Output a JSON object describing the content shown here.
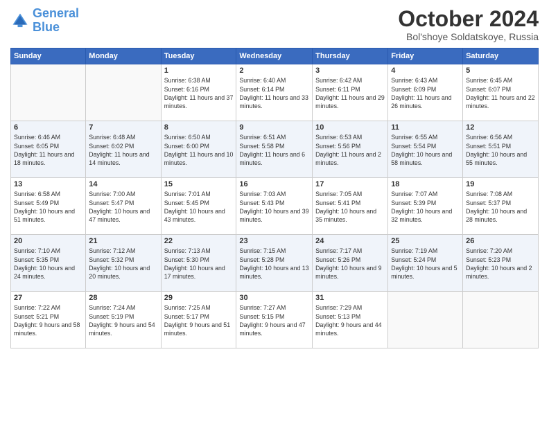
{
  "logo": {
    "line1": "General",
    "line2": "Blue"
  },
  "title": "October 2024",
  "subtitle": "Bol'shoye Soldatskoye, Russia",
  "days_of_week": [
    "Sunday",
    "Monday",
    "Tuesday",
    "Wednesday",
    "Thursday",
    "Friday",
    "Saturday"
  ],
  "weeks": [
    [
      {
        "day": "",
        "sunrise": "",
        "sunset": "",
        "daylight": ""
      },
      {
        "day": "",
        "sunrise": "",
        "sunset": "",
        "daylight": ""
      },
      {
        "day": "1",
        "sunrise": "Sunrise: 6:38 AM",
        "sunset": "Sunset: 6:16 PM",
        "daylight": "Daylight: 11 hours and 37 minutes."
      },
      {
        "day": "2",
        "sunrise": "Sunrise: 6:40 AM",
        "sunset": "Sunset: 6:14 PM",
        "daylight": "Daylight: 11 hours and 33 minutes."
      },
      {
        "day": "3",
        "sunrise": "Sunrise: 6:42 AM",
        "sunset": "Sunset: 6:11 PM",
        "daylight": "Daylight: 11 hours and 29 minutes."
      },
      {
        "day": "4",
        "sunrise": "Sunrise: 6:43 AM",
        "sunset": "Sunset: 6:09 PM",
        "daylight": "Daylight: 11 hours and 26 minutes."
      },
      {
        "day": "5",
        "sunrise": "Sunrise: 6:45 AM",
        "sunset": "Sunset: 6:07 PM",
        "daylight": "Daylight: 11 hours and 22 minutes."
      }
    ],
    [
      {
        "day": "6",
        "sunrise": "Sunrise: 6:46 AM",
        "sunset": "Sunset: 6:05 PM",
        "daylight": "Daylight: 11 hours and 18 minutes."
      },
      {
        "day": "7",
        "sunrise": "Sunrise: 6:48 AM",
        "sunset": "Sunset: 6:02 PM",
        "daylight": "Daylight: 11 hours and 14 minutes."
      },
      {
        "day": "8",
        "sunrise": "Sunrise: 6:50 AM",
        "sunset": "Sunset: 6:00 PM",
        "daylight": "Daylight: 11 hours and 10 minutes."
      },
      {
        "day": "9",
        "sunrise": "Sunrise: 6:51 AM",
        "sunset": "Sunset: 5:58 PM",
        "daylight": "Daylight: 11 hours and 6 minutes."
      },
      {
        "day": "10",
        "sunrise": "Sunrise: 6:53 AM",
        "sunset": "Sunset: 5:56 PM",
        "daylight": "Daylight: 11 hours and 2 minutes."
      },
      {
        "day": "11",
        "sunrise": "Sunrise: 6:55 AM",
        "sunset": "Sunset: 5:54 PM",
        "daylight": "Daylight: 10 hours and 58 minutes."
      },
      {
        "day": "12",
        "sunrise": "Sunrise: 6:56 AM",
        "sunset": "Sunset: 5:51 PM",
        "daylight": "Daylight: 10 hours and 55 minutes."
      }
    ],
    [
      {
        "day": "13",
        "sunrise": "Sunrise: 6:58 AM",
        "sunset": "Sunset: 5:49 PM",
        "daylight": "Daylight: 10 hours and 51 minutes."
      },
      {
        "day": "14",
        "sunrise": "Sunrise: 7:00 AM",
        "sunset": "Sunset: 5:47 PM",
        "daylight": "Daylight: 10 hours and 47 minutes."
      },
      {
        "day": "15",
        "sunrise": "Sunrise: 7:01 AM",
        "sunset": "Sunset: 5:45 PM",
        "daylight": "Daylight: 10 hours and 43 minutes."
      },
      {
        "day": "16",
        "sunrise": "Sunrise: 7:03 AM",
        "sunset": "Sunset: 5:43 PM",
        "daylight": "Daylight: 10 hours and 39 minutes."
      },
      {
        "day": "17",
        "sunrise": "Sunrise: 7:05 AM",
        "sunset": "Sunset: 5:41 PM",
        "daylight": "Daylight: 10 hours and 35 minutes."
      },
      {
        "day": "18",
        "sunrise": "Sunrise: 7:07 AM",
        "sunset": "Sunset: 5:39 PM",
        "daylight": "Daylight: 10 hours and 32 minutes."
      },
      {
        "day": "19",
        "sunrise": "Sunrise: 7:08 AM",
        "sunset": "Sunset: 5:37 PM",
        "daylight": "Daylight: 10 hours and 28 minutes."
      }
    ],
    [
      {
        "day": "20",
        "sunrise": "Sunrise: 7:10 AM",
        "sunset": "Sunset: 5:35 PM",
        "daylight": "Daylight: 10 hours and 24 minutes."
      },
      {
        "day": "21",
        "sunrise": "Sunrise: 7:12 AM",
        "sunset": "Sunset: 5:32 PM",
        "daylight": "Daylight: 10 hours and 20 minutes."
      },
      {
        "day": "22",
        "sunrise": "Sunrise: 7:13 AM",
        "sunset": "Sunset: 5:30 PM",
        "daylight": "Daylight: 10 hours and 17 minutes."
      },
      {
        "day": "23",
        "sunrise": "Sunrise: 7:15 AM",
        "sunset": "Sunset: 5:28 PM",
        "daylight": "Daylight: 10 hours and 13 minutes."
      },
      {
        "day": "24",
        "sunrise": "Sunrise: 7:17 AM",
        "sunset": "Sunset: 5:26 PM",
        "daylight": "Daylight: 10 hours and 9 minutes."
      },
      {
        "day": "25",
        "sunrise": "Sunrise: 7:19 AM",
        "sunset": "Sunset: 5:24 PM",
        "daylight": "Daylight: 10 hours and 5 minutes."
      },
      {
        "day": "26",
        "sunrise": "Sunrise: 7:20 AM",
        "sunset": "Sunset: 5:23 PM",
        "daylight": "Daylight: 10 hours and 2 minutes."
      }
    ],
    [
      {
        "day": "27",
        "sunrise": "Sunrise: 7:22 AM",
        "sunset": "Sunset: 5:21 PM",
        "daylight": "Daylight: 9 hours and 58 minutes."
      },
      {
        "day": "28",
        "sunrise": "Sunrise: 7:24 AM",
        "sunset": "Sunset: 5:19 PM",
        "daylight": "Daylight: 9 hours and 54 minutes."
      },
      {
        "day": "29",
        "sunrise": "Sunrise: 7:25 AM",
        "sunset": "Sunset: 5:17 PM",
        "daylight": "Daylight: 9 hours and 51 minutes."
      },
      {
        "day": "30",
        "sunrise": "Sunrise: 7:27 AM",
        "sunset": "Sunset: 5:15 PM",
        "daylight": "Daylight: 9 hours and 47 minutes."
      },
      {
        "day": "31",
        "sunrise": "Sunrise: 7:29 AM",
        "sunset": "Sunset: 5:13 PM",
        "daylight": "Daylight: 9 hours and 44 minutes."
      },
      {
        "day": "",
        "sunrise": "",
        "sunset": "",
        "daylight": ""
      },
      {
        "day": "",
        "sunrise": "",
        "sunset": "",
        "daylight": ""
      }
    ]
  ]
}
